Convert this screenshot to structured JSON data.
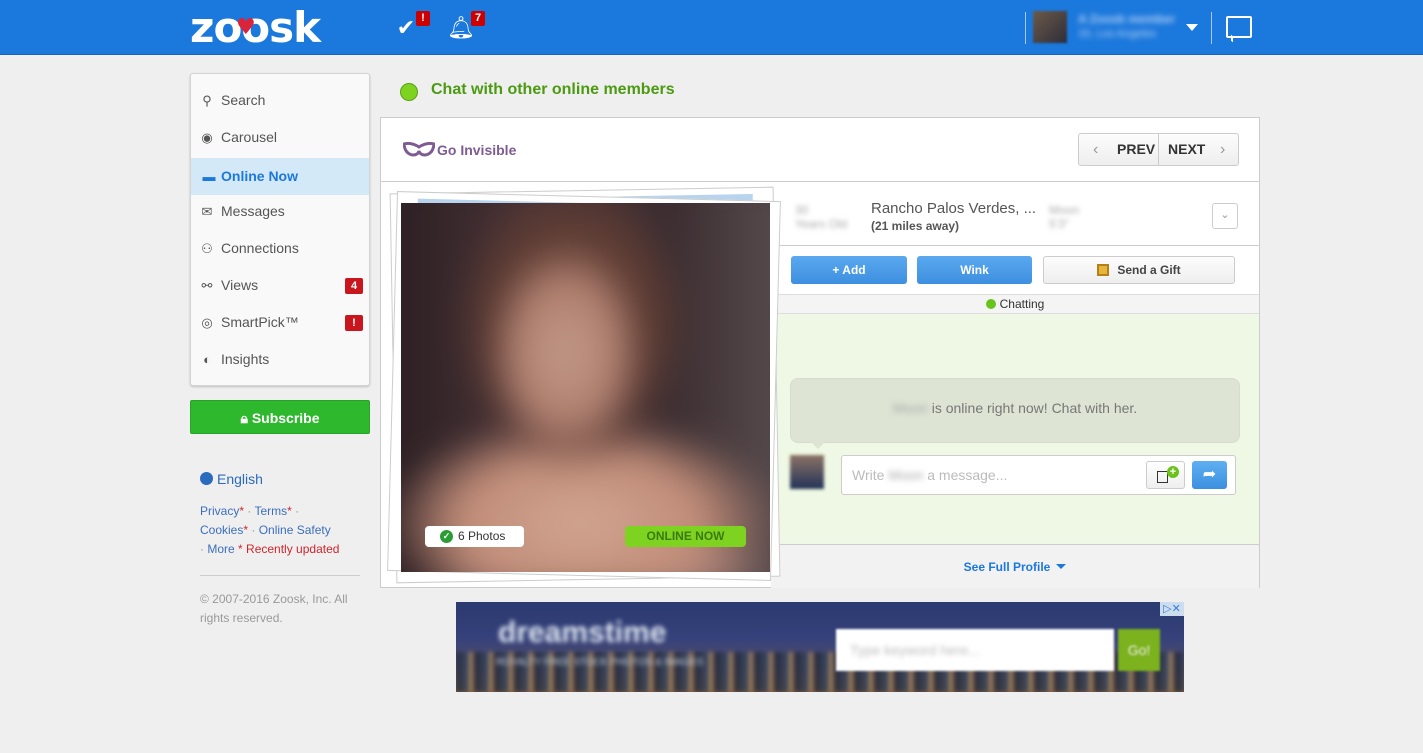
{
  "topbar": {
    "logo": "zoosk",
    "icons": [
      {
        "name": "smartpick-icon",
        "badge": "!"
      },
      {
        "name": "notifications-icon",
        "badge": "7"
      }
    ],
    "user": {
      "name": "A Zoosk member",
      "location": "33, Los Angeles"
    },
    "chat_icon": "chat-bubble-icon"
  },
  "sidebar": {
    "items": [
      {
        "label": "Search",
        "icon": "🔍",
        "active": false,
        "badge": null
      },
      {
        "label": "Carousel",
        "icon": "◉",
        "active": false,
        "badge": null
      },
      {
        "label": "Online Now",
        "icon": "💬",
        "active": true,
        "badge": null
      },
      {
        "label": "Messages",
        "icon": "✉",
        "active": false,
        "badge": null
      },
      {
        "label": "Connections",
        "icon": "👤",
        "active": false,
        "badge": null
      },
      {
        "label": "Views",
        "icon": "👓",
        "active": false,
        "badge": "4"
      },
      {
        "label": "SmartPick™",
        "icon": "◎",
        "active": false,
        "badge": "!"
      },
      {
        "label": "Insights",
        "icon": "◐",
        "active": false,
        "badge": null
      }
    ],
    "subscribe_label": "Subscribe",
    "language": "English",
    "footer": {
      "privacy": "Privacy",
      "terms": "Terms",
      "cookies": "Cookies",
      "online_safety": "Online Safety",
      "more": "More",
      "recently_updated": "* Recently updated",
      "copyright": "© 2007-2016 Zoosk, Inc. All rights reserved."
    }
  },
  "main": {
    "heading": "Chat with other online members",
    "go_invisible": "Go Invisible",
    "prev_label": "PREV",
    "next_label": "NEXT",
    "profile": {
      "age_blurred": "30",
      "age_label_blurred": "Years Old",
      "location": "Rancho Palos Verdes, ...",
      "distance": "(21 miles away)",
      "height_name_blurred": "Moon",
      "height_blurred": "5'3\"",
      "photos_label": "6 Photos",
      "online_label": "ONLINE NOW"
    },
    "actions": {
      "add": "+ Add",
      "wink": "Wink",
      "gift": "Send a Gift"
    },
    "chat": {
      "status": "Chatting",
      "name_blurred": "Moon",
      "bubble_text": " is online right now! Chat with her.",
      "placeholder_prefix": "Write ",
      "placeholder_suffix": " a message..."
    },
    "see_full_profile": "See Full Profile"
  },
  "ad": {
    "brand": "dreamstime",
    "tagline": "ROYALTY FREE STOCK PHOTOS & IMAGES",
    "placeholder": "Type keyword here...",
    "go": "Go!"
  }
}
